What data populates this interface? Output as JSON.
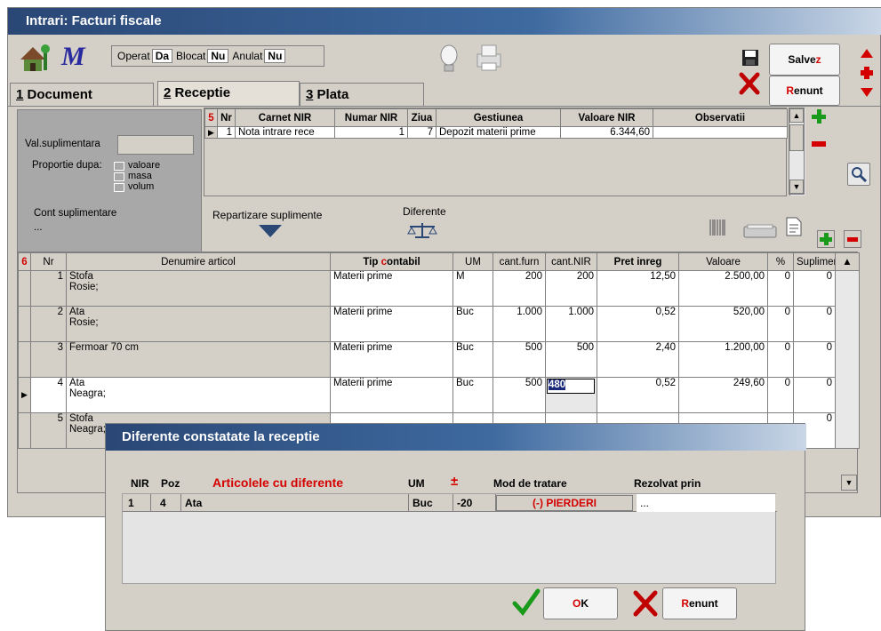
{
  "window": {
    "title": "Intrari: Facturi fiscale"
  },
  "toolbar": {
    "operat_label": "Operat",
    "operat_value": "Da",
    "blocat_label": "Blocat",
    "blocat_value": "Nu",
    "anulat_label": "Anulat",
    "anulat_value": "Nu",
    "save_label": "Salve",
    "save_hotkey": "z",
    "cancel_hotkey": "R",
    "cancel_label": "enunt"
  },
  "tabs": [
    {
      "num": "1",
      "label": "Document"
    },
    {
      "num": "2",
      "label": "Receptie"
    },
    {
      "num": "3",
      "label": "Plata"
    }
  ],
  "left_panel": {
    "val_suplimentara": "Val.suplimentara",
    "proportie_dupa": "Proportie dupa:",
    "options": [
      "valoare",
      "masa",
      "volum"
    ],
    "cont_suplimentare": "Cont suplimentare",
    "cont_value": "..."
  },
  "nir_grid": {
    "counter": "5",
    "headers": [
      "Nr",
      "Carnet NIR",
      "Numar NIR",
      "Ziua",
      "Gestiunea",
      "Valoare NIR",
      "Observatii"
    ],
    "rows": [
      {
        "nr": "1",
        "carnet": "Nota intrare rece",
        "numar": "1",
        "ziua": "7",
        "gestiunea": "Depozit materii prime",
        "valoare": "6.344,60",
        "obs": ""
      }
    ]
  },
  "actions": {
    "repartizare": "Repartizare suplimente",
    "diferente": "Diferente"
  },
  "items_grid": {
    "counter": "6",
    "headers": [
      "Nr",
      "Denumire articol",
      "Tip contabil",
      "UM",
      "cant.furn",
      "cant.NIR",
      "Pret inreg",
      "Valoare",
      "%",
      "Supliment"
    ],
    "tip_prefix": "Tip ",
    "tip_hot": "c",
    "tip_suffix": "ontabil",
    "rows": [
      {
        "nr": "1",
        "den1": "Stofa",
        "den2": "Rosie;",
        "tip": "Materii prime",
        "um": "M",
        "furn": "200",
        "nir": "200",
        "pret": "12,50",
        "val": "2.500,00",
        "pct": "0",
        "sup": "0"
      },
      {
        "nr": "2",
        "den1": "Ata",
        "den2": "Rosie;",
        "tip": "Materii prime",
        "um": "Buc",
        "furn": "1.000",
        "nir": "1.000",
        "pret": "0,52",
        "val": "520,00",
        "pct": "0",
        "sup": "0"
      },
      {
        "nr": "3",
        "den1": "Fermoar 70 cm",
        "den2": "",
        "tip": "Materii prime",
        "um": "Buc",
        "furn": "500",
        "nir": "500",
        "pret": "2,40",
        "val": "1.200,00",
        "pct": "0",
        "sup": "0"
      },
      {
        "nr": "4",
        "den1": "Ata",
        "den2": "Neagra;",
        "tip": "Materii prime",
        "um": "Buc",
        "furn": "500",
        "nir": "480",
        "pret": "0,52",
        "val": "249,60",
        "pct": "0",
        "sup": "0"
      },
      {
        "nr": "5",
        "den1": "Stofa",
        "den2": "Neagra;",
        "tip": "",
        "um": "",
        "furn": "",
        "nir": "",
        "pret": "",
        "val": "",
        "pct": "",
        "sup": "0"
      }
    ]
  },
  "dialog": {
    "title": "Diferente constatate la receptie",
    "headers": {
      "nir": "NIR",
      "poz": "Poz",
      "articole": "Articolele cu diferente",
      "um": "UM",
      "pm": "±",
      "mod": "Mod de tratare",
      "rezolvat": "Rezolvat prin"
    },
    "row": {
      "nir": "1",
      "poz": "4",
      "articol": "Ata",
      "um": "Buc",
      "diff": "-20",
      "mod": "(-) PIERDERI",
      "rezolvat": "..."
    },
    "ok_label": "K",
    "ok_hotkey": "O",
    "cancel_hotkey": "R",
    "cancel_label": "enunt"
  },
  "colors": {
    "title_bar": "#2a4775",
    "accent_red": "#d40000",
    "green": "#1a9a1a",
    "panel_gray": "#a8a8a8"
  }
}
